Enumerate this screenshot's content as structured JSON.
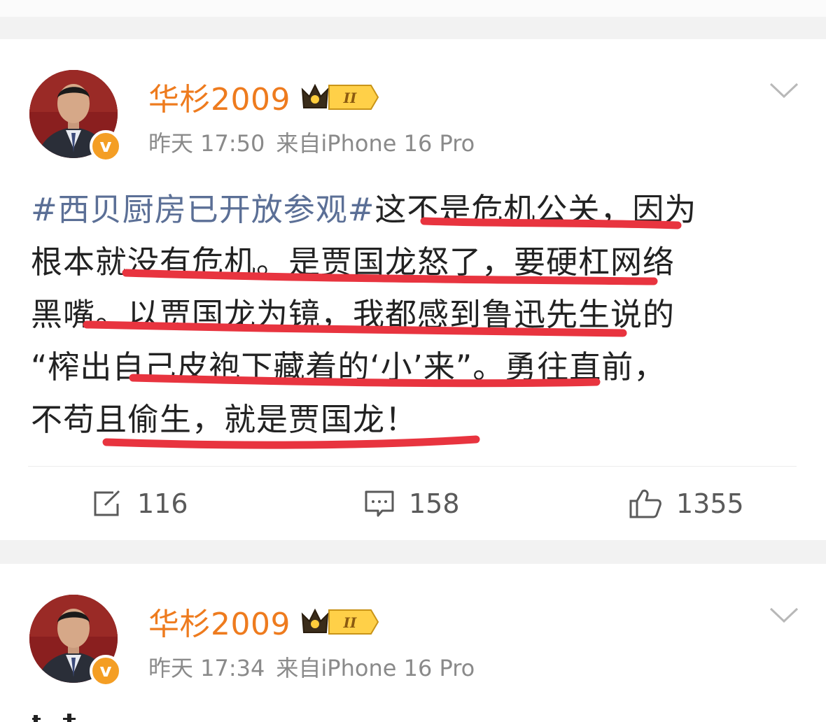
{
  "posts": [
    {
      "username": "华杉2009",
      "time": "昨天 17:50",
      "source": "来自iPhone 16 Pro",
      "verified_badge": "v",
      "vip_badge": "crown-level-II-icon",
      "vip_level": "II",
      "text_lines": [
        {
          "hashtag": "#西贝厨房已开放参观#",
          "rest": "这不是危机公关，因为"
        },
        {
          "hashtag": "",
          "rest": "根本就没有危机。是贾国龙怒了，要硬杠网络"
        },
        {
          "hashtag": "",
          "rest": "黑嘴。以贾国龙为镜，我都感到鲁迅先生说的"
        },
        {
          "hashtag": "",
          "rest": "“榨出自己皮袍下藏着的‘小’来”。勇往直前，"
        },
        {
          "hashtag": "",
          "rest": "不苟且偷生，就是贾国龙！"
        }
      ],
      "actions": {
        "repost": "116",
        "comment": "158",
        "like": "1355"
      }
    },
    {
      "username": "华杉2009",
      "time": "昨天 17:34",
      "source": "来自iPhone 16 Pro",
      "verified_badge": "v",
      "vip_badge": "crown-level-II-icon",
      "vip_level": "II"
    }
  ],
  "colors": {
    "username": "#ee7b1e",
    "hashtag": "#5b6f96",
    "underline": "#e8343f",
    "meta": "#8a8a8a",
    "verified": "#f49e24"
  },
  "icons": [
    "chevron-down-icon",
    "repost-icon",
    "comment-icon",
    "like-icon",
    "verified-badge-icon"
  ]
}
